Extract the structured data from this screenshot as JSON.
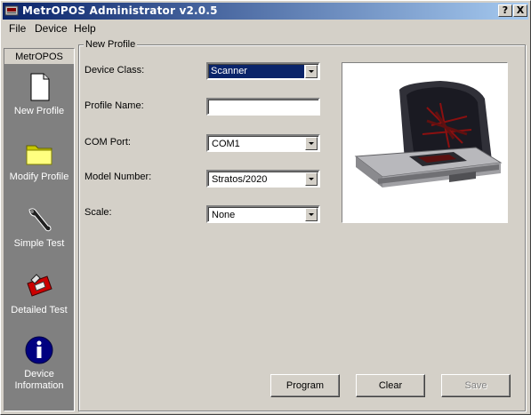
{
  "window": {
    "title": "MetrOPOS Administrator v2.0.5"
  },
  "titlebar": {
    "help_label": "?",
    "close_label": "X"
  },
  "menu": [
    {
      "label": "File",
      "mnemonic": "F"
    },
    {
      "label": "Device",
      "mnemonic": "D"
    },
    {
      "label": "Help",
      "mnemonic": "H"
    }
  ],
  "sidebar": {
    "header": "MetrOPOS",
    "items": [
      {
        "label": "New Profile",
        "icon": "new-document-icon"
      },
      {
        "label": "Modify Profile",
        "icon": "folder-icon"
      },
      {
        "label": "Simple Test",
        "icon": "wrench-icon"
      },
      {
        "label": "Detailed Test",
        "icon": "toolbox-icon"
      },
      {
        "label": "Device Information",
        "label_line1": "Device",
        "label_line2": "Information",
        "icon": "info-icon"
      }
    ]
  },
  "form": {
    "group_title": "New Profile",
    "device_class": {
      "label": "Device Class:",
      "value": "Scanner"
    },
    "profile_name": {
      "label": "Profile Name:",
      "value": ""
    },
    "com_port": {
      "label": "COM Port:",
      "value": "COM1"
    },
    "model_number": {
      "label": "Model Number:",
      "value": "Stratos/2020"
    },
    "scale": {
      "label": "Scale:",
      "value": "None"
    }
  },
  "preview": {
    "icon": "scanner-scale-image"
  },
  "buttons": {
    "program": "Program",
    "clear": "Clear",
    "save": "Save"
  },
  "colors": {
    "titlebar_start": "#0a246a",
    "titlebar_end": "#a6caf0",
    "sidebar_bg": "#808080",
    "face": "#d4d0c8",
    "selection": "#0a246a"
  }
}
